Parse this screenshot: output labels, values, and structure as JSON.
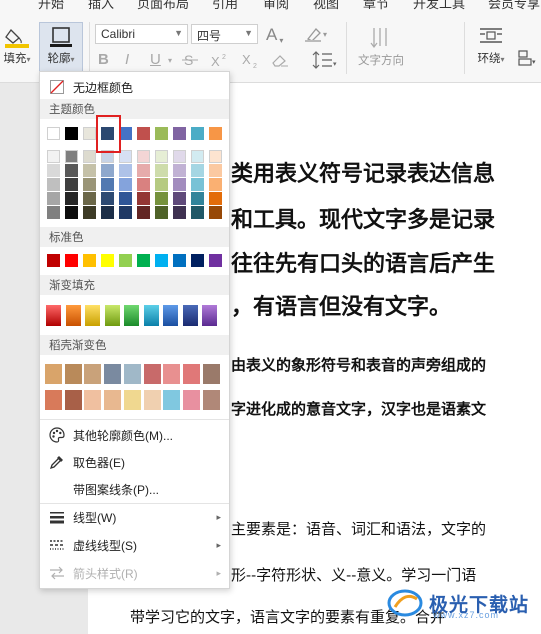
{
  "menu": {
    "tabs": [
      "开始",
      "插入",
      "页面布局",
      "引用",
      "审阅",
      "视图",
      "章节",
      "开发工具",
      "会员专享"
    ]
  },
  "toolbar": {
    "fill_label": "填充",
    "border_label": "轮廓",
    "font_name": "Calibri",
    "font_size": "四号",
    "text_direction_label": "文字方向",
    "wrap_label": "环绕",
    "bold": "B",
    "italic": "I",
    "underline": "U",
    "font_color_glyph": "A"
  },
  "dropdown": {
    "no_border_color": "无边框颜色",
    "theme_colors_title": "主题颜色",
    "standard_colors_title": "标准色",
    "gradient_fill_title": "渐变填充",
    "shell_gradient_title": "稻壳渐变色",
    "more_colors": "其他轮廓颜色(M)...",
    "eyedropper": "取色器(E)",
    "pattern_line": "带图案线条(P)...",
    "line_type": "线型(W)",
    "dash_type": "虚线线型(S)",
    "arrow_style": "箭头样式(R)",
    "theme_top_row": [
      "#ffffff",
      "#000000",
      "#e8e6dc",
      "#2b4870",
      "#4472c4",
      "#c0504d",
      "#9bbb59",
      "#8064a2",
      "#4bacc6",
      "#f79646"
    ],
    "theme_columns": [
      [
        "#f2f2f2",
        "#d9d9d9",
        "#bfbfbf",
        "#a6a6a6",
        "#808080"
      ],
      [
        "#7f7f7f",
        "#595959",
        "#3f3f3f",
        "#262626",
        "#0d0d0d"
      ],
      [
        "#dddbcf",
        "#c5c1a8",
        "#9a9577",
        "#6b6748",
        "#3d3b26"
      ],
      [
        "#c6d3e6",
        "#8ea8cd",
        "#5279b1",
        "#2d4a73",
        "#1c2e48"
      ],
      [
        "#d6e0f4",
        "#aec2e8",
        "#84a3dc",
        "#2f5597",
        "#1f3864"
      ],
      [
        "#f3d5d5",
        "#e6abab",
        "#d98180",
        "#943634",
        "#632523"
      ],
      [
        "#e6eed5",
        "#cedcab",
        "#b5ca81",
        "#76923c",
        "#4f6228"
      ],
      [
        "#e0d9ea",
        "#c1b2d4",
        "#a28cbe",
        "#5f497a",
        "#3f3151"
      ],
      [
        "#d2ebf1",
        "#a5d6e3",
        "#78c2d6",
        "#31849b",
        "#205867"
      ],
      [
        "#fde4d0",
        "#fbc9a1",
        "#fab072",
        "#e36c09",
        "#974806"
      ]
    ],
    "standard": [
      "#c00000",
      "#ff0000",
      "#ffc000",
      "#ffff00",
      "#92d050",
      "#00b050",
      "#00b0f0",
      "#0070c0",
      "#002060",
      "#7030a0"
    ],
    "gradients": [
      [
        "#ff6a6a",
        "#b00000"
      ],
      [
        "#ff9a3c",
        "#c85000"
      ],
      [
        "#ffe066",
        "#c8a000"
      ],
      [
        "#c9e86a",
        "#6f9a10"
      ],
      [
        "#70d870",
        "#1a8a2a"
      ],
      [
        "#5ccfe8",
        "#0a7fa8"
      ],
      [
        "#5e9ae8",
        "#1a4ea0"
      ],
      [
        "#4a6ab8",
        "#1a2a70"
      ],
      [
        "#b07ad8",
        "#5a2a90"
      ]
    ],
    "textures_row1": [
      "#d9a46a",
      "#b98a5a",
      "#c9a27a",
      "#7a8aa0",
      "#a0b8c8",
      "#c86a6a",
      "#e89090",
      "#e07878",
      "#9a7a6a"
    ],
    "textures_row2": [
      "#d87a5a",
      "#a86048",
      "#f0c0a0",
      "#e8b890",
      "#f0d890",
      "#f0d0b0",
      "#80c8e0",
      "#e890a0",
      "#b08878"
    ]
  },
  "document": {
    "lines": [
      "类用表义符号记录表达信息",
      "和工具。现代文字多是记录",
      "往往先有口头的语言后产生",
      "，有语言但没有文字。",
      "由表义的象形符号和表音的声旁组成的",
      "字进化成的意音文字，汉字也是语素文",
      "主要素是：语音、词汇和语法，文字的",
      "形--字符形状、义--意义。学习一门语",
      "带学习它的文字，语言文字的要素有重复。合并"
    ]
  },
  "watermark": {
    "name": "极光下载站",
    "url": "www.xz7.com"
  }
}
